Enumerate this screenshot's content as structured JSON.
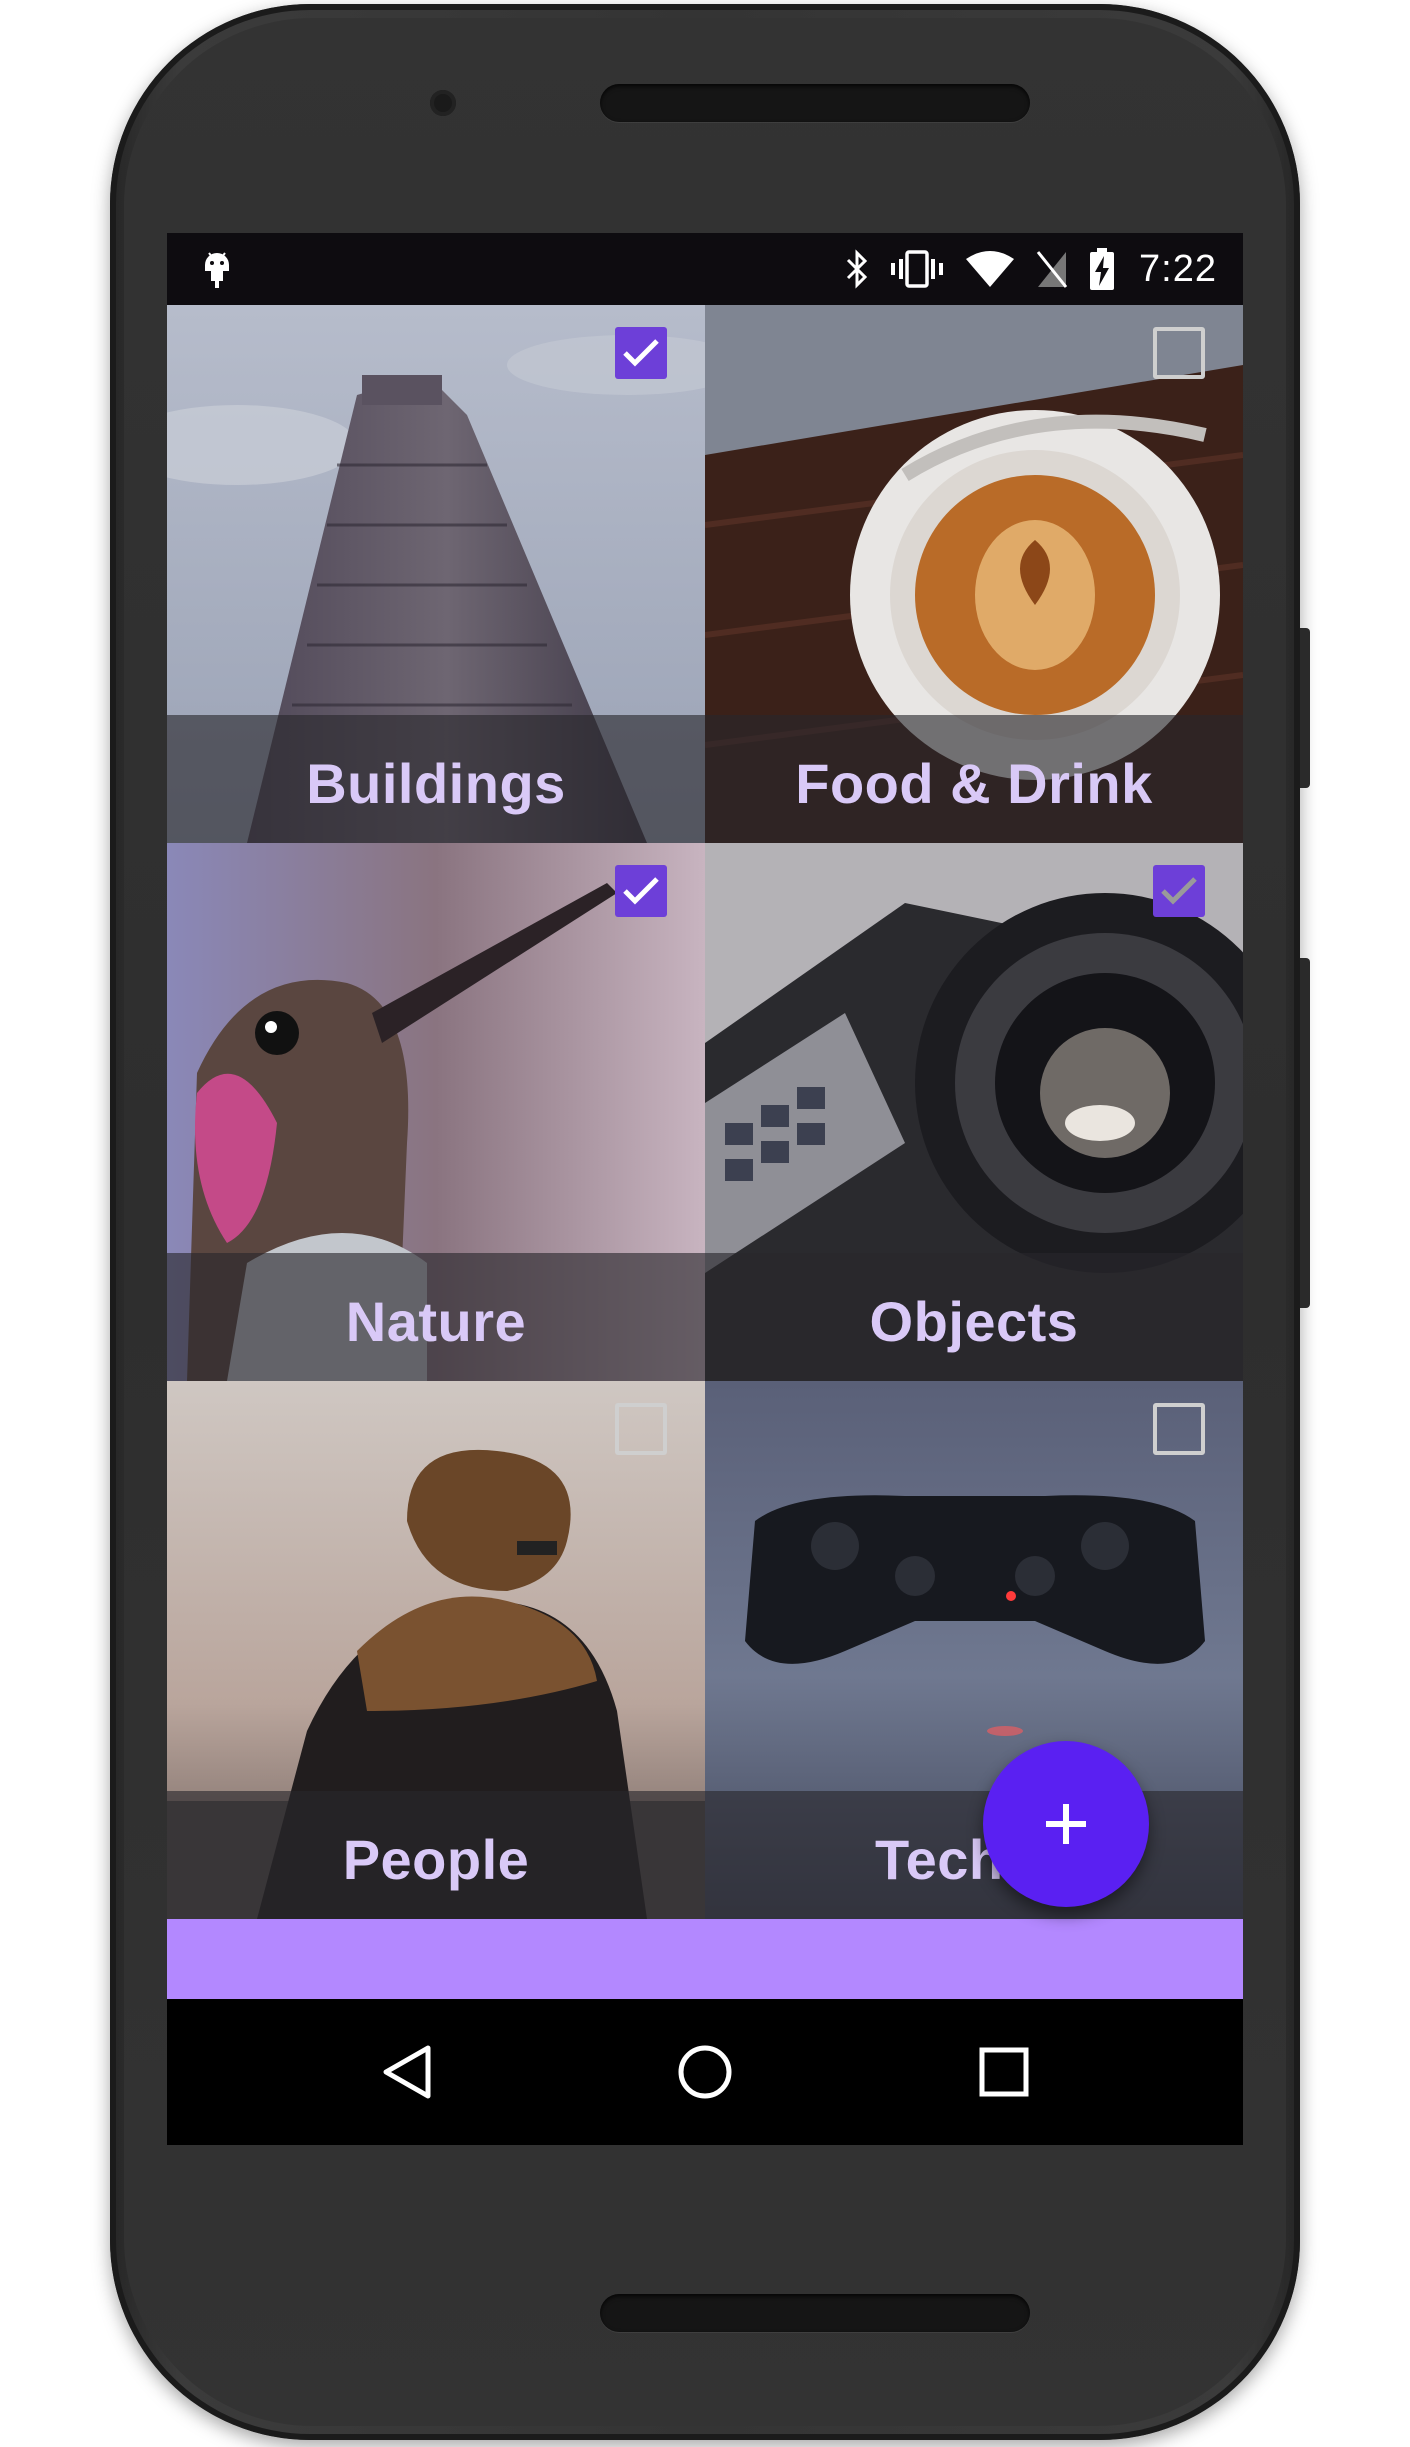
{
  "status_bar": {
    "time": "7:22",
    "icons": [
      "android-debug-icon",
      "bluetooth-icon",
      "vibrate-icon",
      "wifi-icon",
      "no-sim-icon",
      "battery-charging-icon"
    ]
  },
  "tiles": [
    {
      "label": "Buildings",
      "checked": true
    },
    {
      "label": "Food & Drink",
      "checked": false
    },
    {
      "label": "Nature",
      "checked": true
    },
    {
      "label": "Objects",
      "checked": true
    },
    {
      "label": "People",
      "checked": false
    },
    {
      "label": "Techno",
      "checked": false
    }
  ],
  "fab": {
    "icon": "plus-icon",
    "symbol": "+"
  },
  "nav_bar": {
    "buttons": [
      "back-icon",
      "home-icon",
      "recents-icon"
    ]
  },
  "colors": {
    "accent": "#5a20f2",
    "checkbox_checked": "#6d3fd8",
    "snackbar": "#b388ff",
    "caption_text": "#d9c9f7"
  }
}
